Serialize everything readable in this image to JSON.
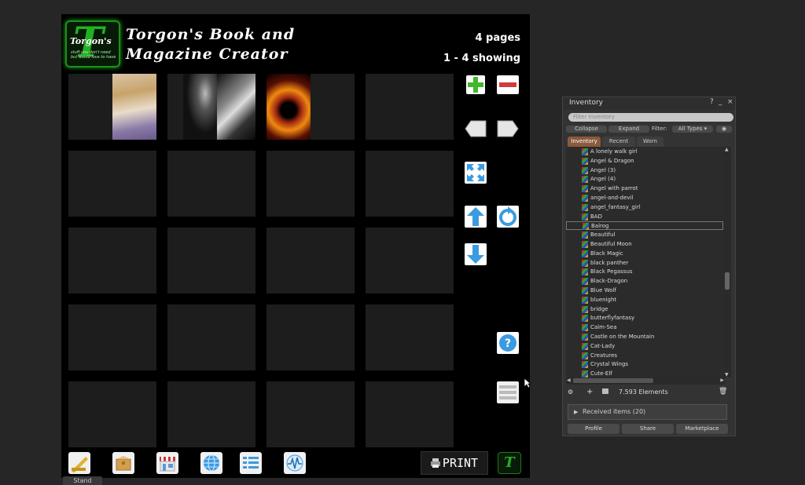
{
  "board": {
    "logo_letter": "T",
    "logo_name": "Torgon's",
    "logo_tagline": "stuff you don't need but would love to have",
    "title_line1": "Torgon's Book and",
    "title_line2": "Magazine Creator",
    "pages_text": "4 pages",
    "showing_text": "1 - 4 showing",
    "print_label": "PRINT",
    "stand_label": "Stand"
  },
  "controls": [
    {
      "name": "add-page-icon",
      "color": "#4fbf3a"
    },
    {
      "name": "remove-page-icon",
      "color": "#d23b3b"
    },
    {
      "name": "previous-page-icon",
      "color": "#dddddd"
    },
    {
      "name": "next-page-icon",
      "color": "#dddddd"
    },
    {
      "name": "fullscreen-icon",
      "color": "#4aa8e8"
    },
    {
      "name": "move-up-icon",
      "color": "#4aa8e8"
    },
    {
      "name": "refresh-icon",
      "color": "#4aa8e8"
    },
    {
      "name": "move-down-icon",
      "color": "#4aa8e8"
    },
    {
      "name": "help-icon",
      "color": "#4aa8e8"
    },
    {
      "name": "list-menu-icon",
      "color": "#cccccc"
    }
  ],
  "toolbar_icons": [
    "ruler-icon",
    "box-icon",
    "shop-icon",
    "globe-icon",
    "list-icon",
    "waveform-icon"
  ],
  "inventory": {
    "title": "Inventory",
    "help": "?",
    "minimize": "_",
    "close": "×",
    "filter_placeholder": "Filter Inventory",
    "collapse_label": "Collapse",
    "expand_label": "Expand",
    "filter_label": "Filter:",
    "types_label": "All Types",
    "tabs": [
      "Inventory",
      "Recent",
      "Worn"
    ],
    "items": [
      "A lonely walk girl",
      "Angel & Dragon",
      "Angel (3)",
      "Angel (4)",
      "Angel with parrot",
      "angel-and-devil",
      "angel_fantasy_girl",
      "BAD",
      "Balrog",
      "Beautiful",
      "Beautiful Moon",
      "Black Magic",
      "black panther",
      "Black Pegassus",
      "Black-Dragon",
      "Blue Wolf",
      "bluenight",
      "bridge",
      "butterflyfantasy",
      "Calm-Sea",
      "Castle on the Mountain",
      "Cat-Lady",
      "Creatures",
      "Crystal Wings",
      "Cute-Elf"
    ],
    "selected_item": "Balrog",
    "elements_count": "7.593 Elements",
    "received_label": "Received items (20)",
    "profile_label": "Profile",
    "share_label": "Share",
    "marketplace_label": "Marketplace"
  }
}
